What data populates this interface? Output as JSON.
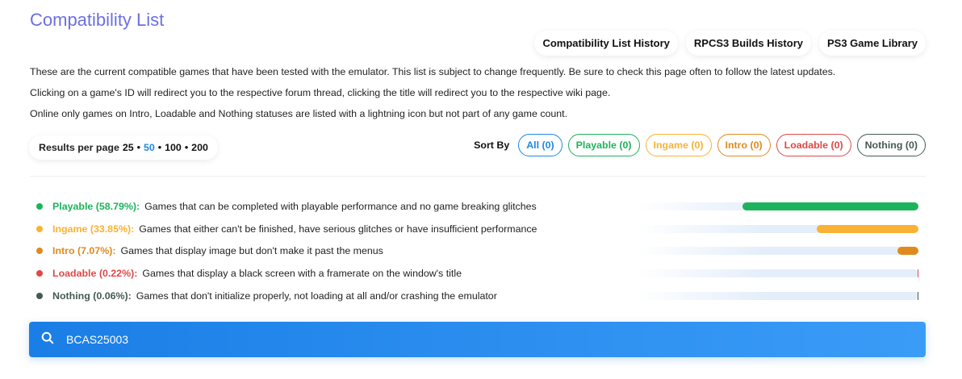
{
  "page": {
    "title": "Compatibility List"
  },
  "nav": {
    "buttons": [
      "Compatibility List History",
      "RPCS3 Builds History",
      "PS3 Game Library"
    ]
  },
  "description": {
    "line1": "These are the current compatible games that have been tested with the emulator. This list is subject to change frequently. Be sure to check this page often to follow the latest updates.",
    "line2": "Clicking on a game's ID will redirect you to the respective forum thread, clicking the title will redirect you to the respective wiki page.",
    "line3": "Online only games on Intro, Loadable and Nothing statuses are listed with a lightning icon but not part of any game count."
  },
  "per_page": {
    "label": "Results per page",
    "options": [
      "25",
      "50",
      "100",
      "200"
    ],
    "selected": "50",
    "separator": "•"
  },
  "sort": {
    "label": "Sort By",
    "filters": [
      {
        "label": "All (0)",
        "color": "#1e88e5"
      },
      {
        "label": "Playable (0)",
        "color": "#1db35c"
      },
      {
        "label": "Ingame (0)",
        "color": "#f9b233"
      },
      {
        "label": "Intro (0)",
        "color": "#e08a1e"
      },
      {
        "label": "Loadable (0)",
        "color": "#e04848"
      },
      {
        "label": "Nothing (0)",
        "color": "#455a54"
      }
    ]
  },
  "statuses": [
    {
      "name": "Playable (58.79%):",
      "description": "Games that can be completed with playable performance and no game breaking glitches",
      "color": "#1db35c",
      "percent": 58.79
    },
    {
      "name": "Ingame (33.85%):",
      "description": "Games that either can't be finished, have serious glitches or have insufficient performance",
      "color": "#f9b233",
      "percent": 33.85
    },
    {
      "name": "Intro (7.07%):",
      "description": "Games that display image but don't make it past the menus",
      "color": "#e08a1e",
      "percent": 7.07
    },
    {
      "name": "Loadable (0.22%):",
      "description": "Games that display a black screen with a framerate on the window's title",
      "color": "#e04848",
      "percent": 0.22
    },
    {
      "name": "Nothing (0.06%):",
      "description": "Games that don't initialize properly, not loading at all and/or crashing the emulator",
      "color": "#455a54",
      "percent": 0.06
    }
  ],
  "search": {
    "value": "BCAS25003",
    "icon": "search-icon"
  }
}
